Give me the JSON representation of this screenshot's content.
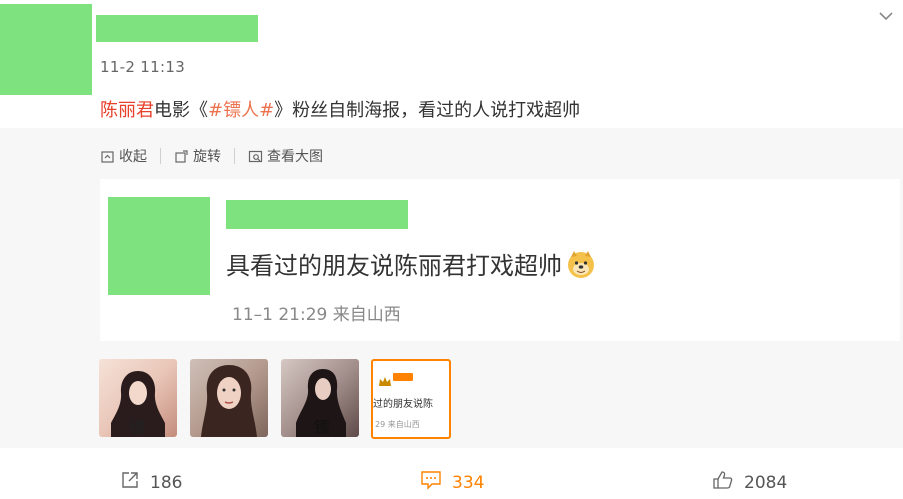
{
  "post": {
    "time": "11-2 11:13",
    "content": {
      "person": "陈丽君",
      "part1": "电影《",
      "topic": "#镖人#",
      "part2": "》粉丝自制海报，看过的人说打戏超帅"
    }
  },
  "toolbar": {
    "collapse": "收起",
    "rotate": "旋转",
    "view_large": "查看大图"
  },
  "embedded": {
    "text": "具看过的朋友说陈丽君打戏超帅",
    "meta": "11–1 21:29  来自山西"
  },
  "thumbnails": {
    "t4_text": "过的朋友说陈",
    "t4_meta": "29 来自山西"
  },
  "footer": {
    "forward_count": "186",
    "comment_count": "334",
    "like_count": "2084"
  },
  "colors": {
    "accent": "#ff8200",
    "name_red": "#e8412b",
    "topic_orange": "#eb7350",
    "redacted_green": "#7ee27e"
  }
}
